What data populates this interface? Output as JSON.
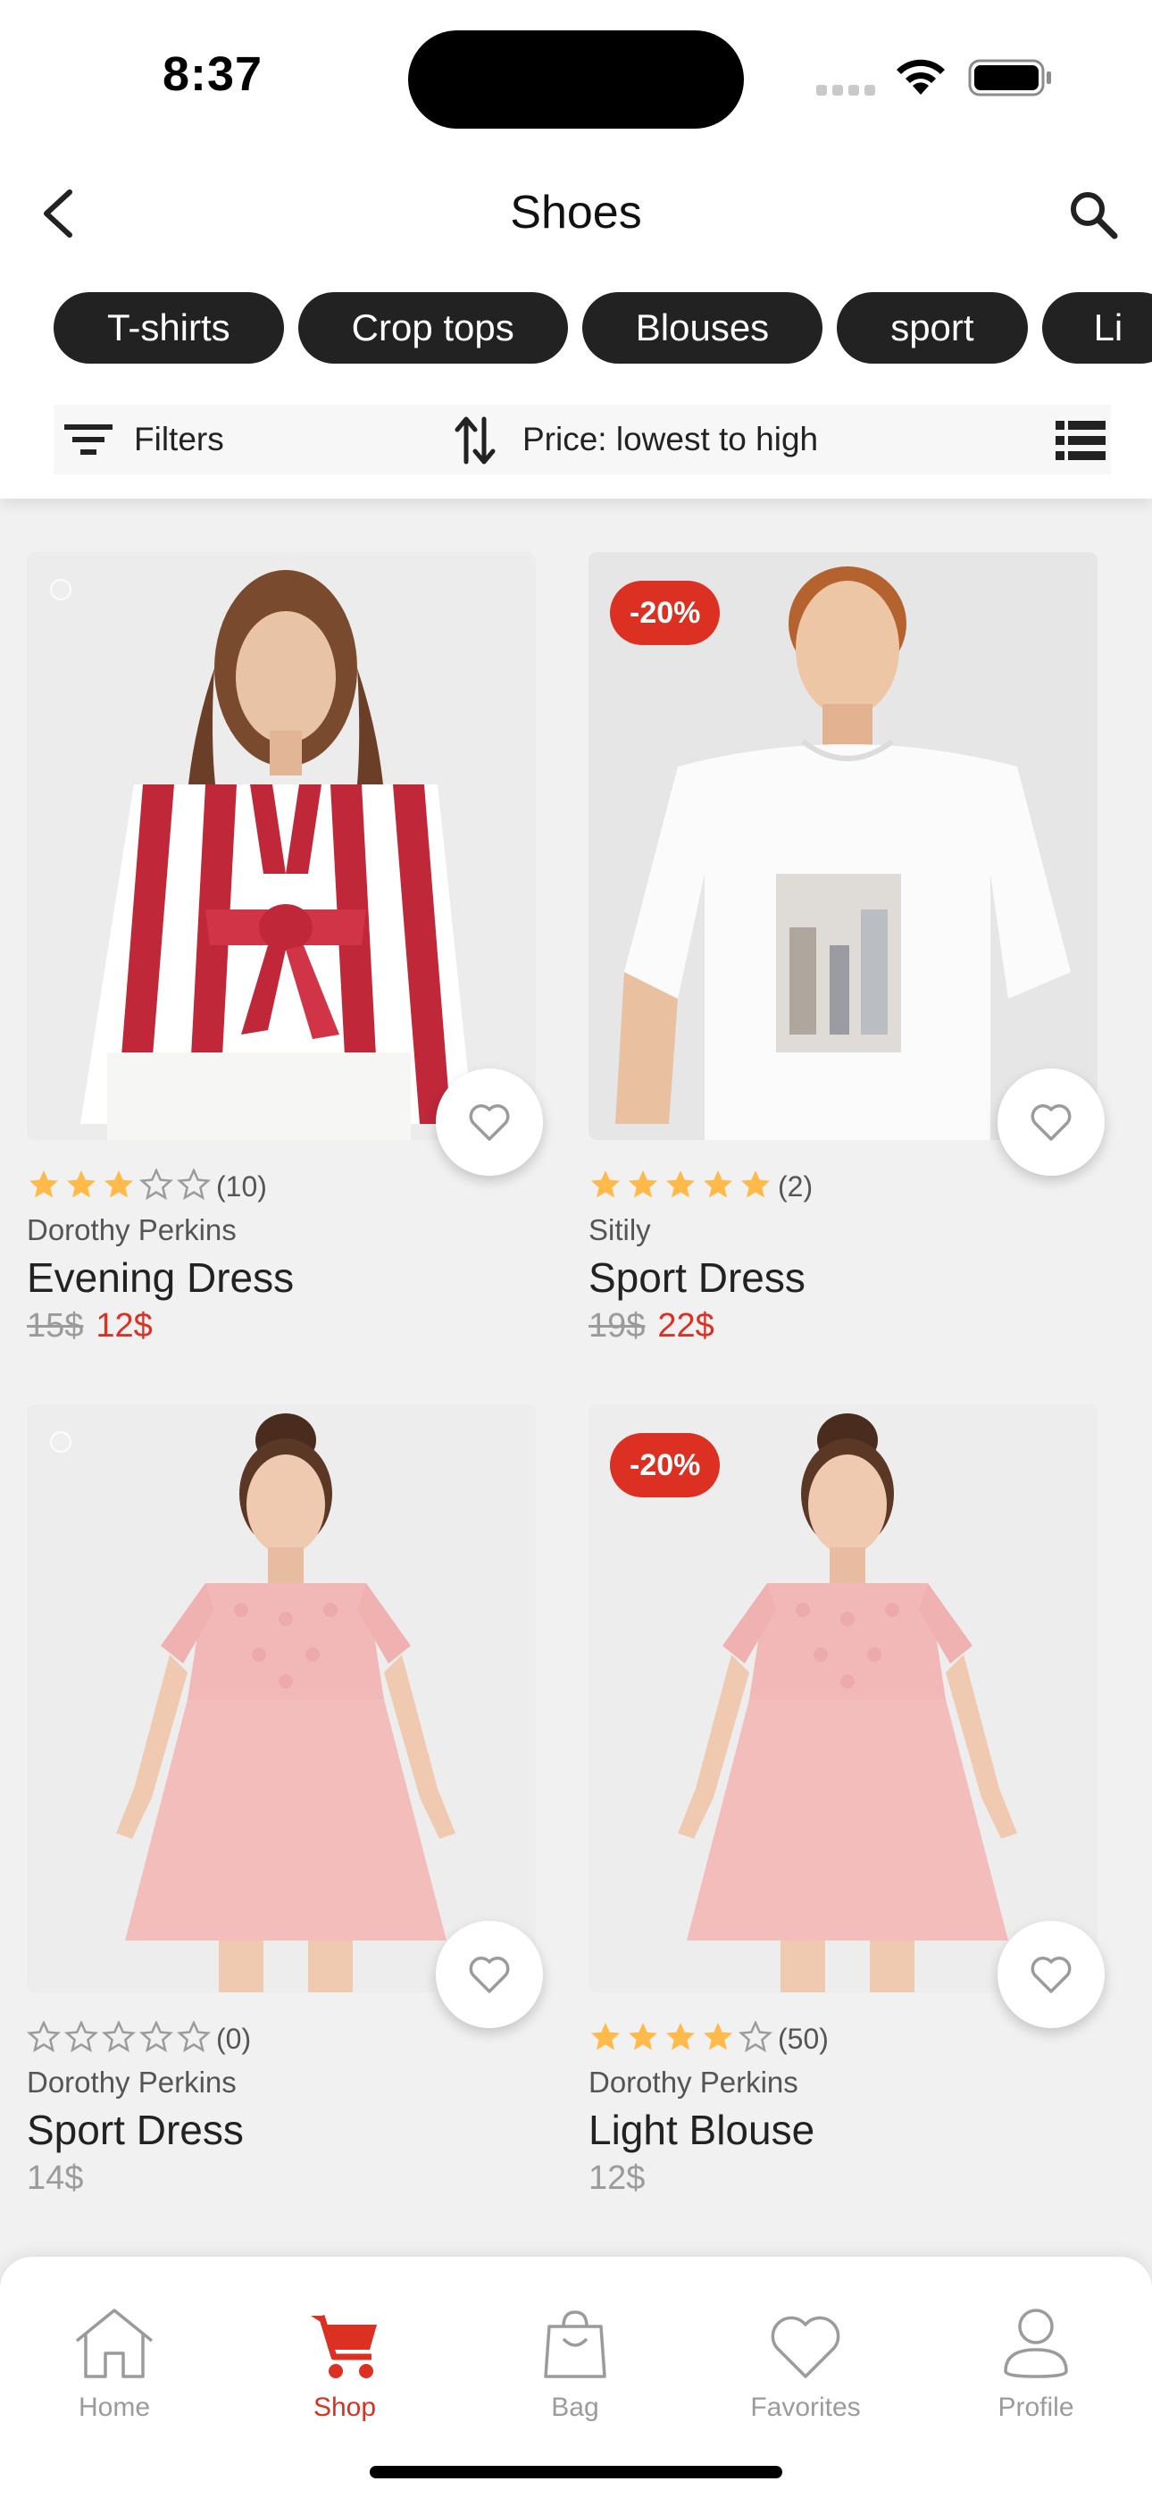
{
  "status_bar": {
    "time": "8:37"
  },
  "header": {
    "title": "Shoes"
  },
  "chips": [
    "T-shirts",
    "Crop tops",
    "Blouses",
    "sport",
    "Li"
  ],
  "filter_bar": {
    "filters_label": "Filters",
    "sort_label": "Price: lowest to high"
  },
  "products": [
    {
      "discount": "",
      "rating": 3,
      "rating_count": "(10)",
      "brand": "Dorothy Perkins",
      "name": "Evening Dress",
      "old_price": "15$",
      "price": "12$",
      "image": "striped-blouse-woman"
    },
    {
      "discount": "-20%",
      "rating": 5,
      "rating_count": "(2)",
      "brand": "Sitily",
      "name": "Sport Dress",
      "old_price": "19$",
      "price": "22$",
      "image": "white-tshirt-man"
    },
    {
      "discount": "",
      "rating": 0,
      "rating_count": "(0)",
      "brand": "Dorothy Perkins",
      "name": "Sport Dress",
      "old_price": "",
      "price": "14$",
      "image": "pink-lace-dress"
    },
    {
      "discount": "-20%",
      "rating": 4,
      "rating_count": "(50)",
      "brand": "Dorothy Perkins",
      "name": "Light Blouse",
      "old_price": "",
      "price": "12$",
      "image": "pink-lace-dress"
    }
  ],
  "tabs": [
    {
      "label": "Home",
      "icon": "home-icon",
      "active": false
    },
    {
      "label": "Shop",
      "icon": "cart-icon",
      "active": true
    },
    {
      "label": "Bag",
      "icon": "bag-icon",
      "active": false
    },
    {
      "label": "Favorites",
      "icon": "heart-icon",
      "active": false
    },
    {
      "label": "Profile",
      "icon": "profile-icon",
      "active": false
    }
  ],
  "colors": {
    "accent": "#db3022",
    "star": "#ffba49",
    "chip": "#222222",
    "muted": "#9b9b9b"
  }
}
